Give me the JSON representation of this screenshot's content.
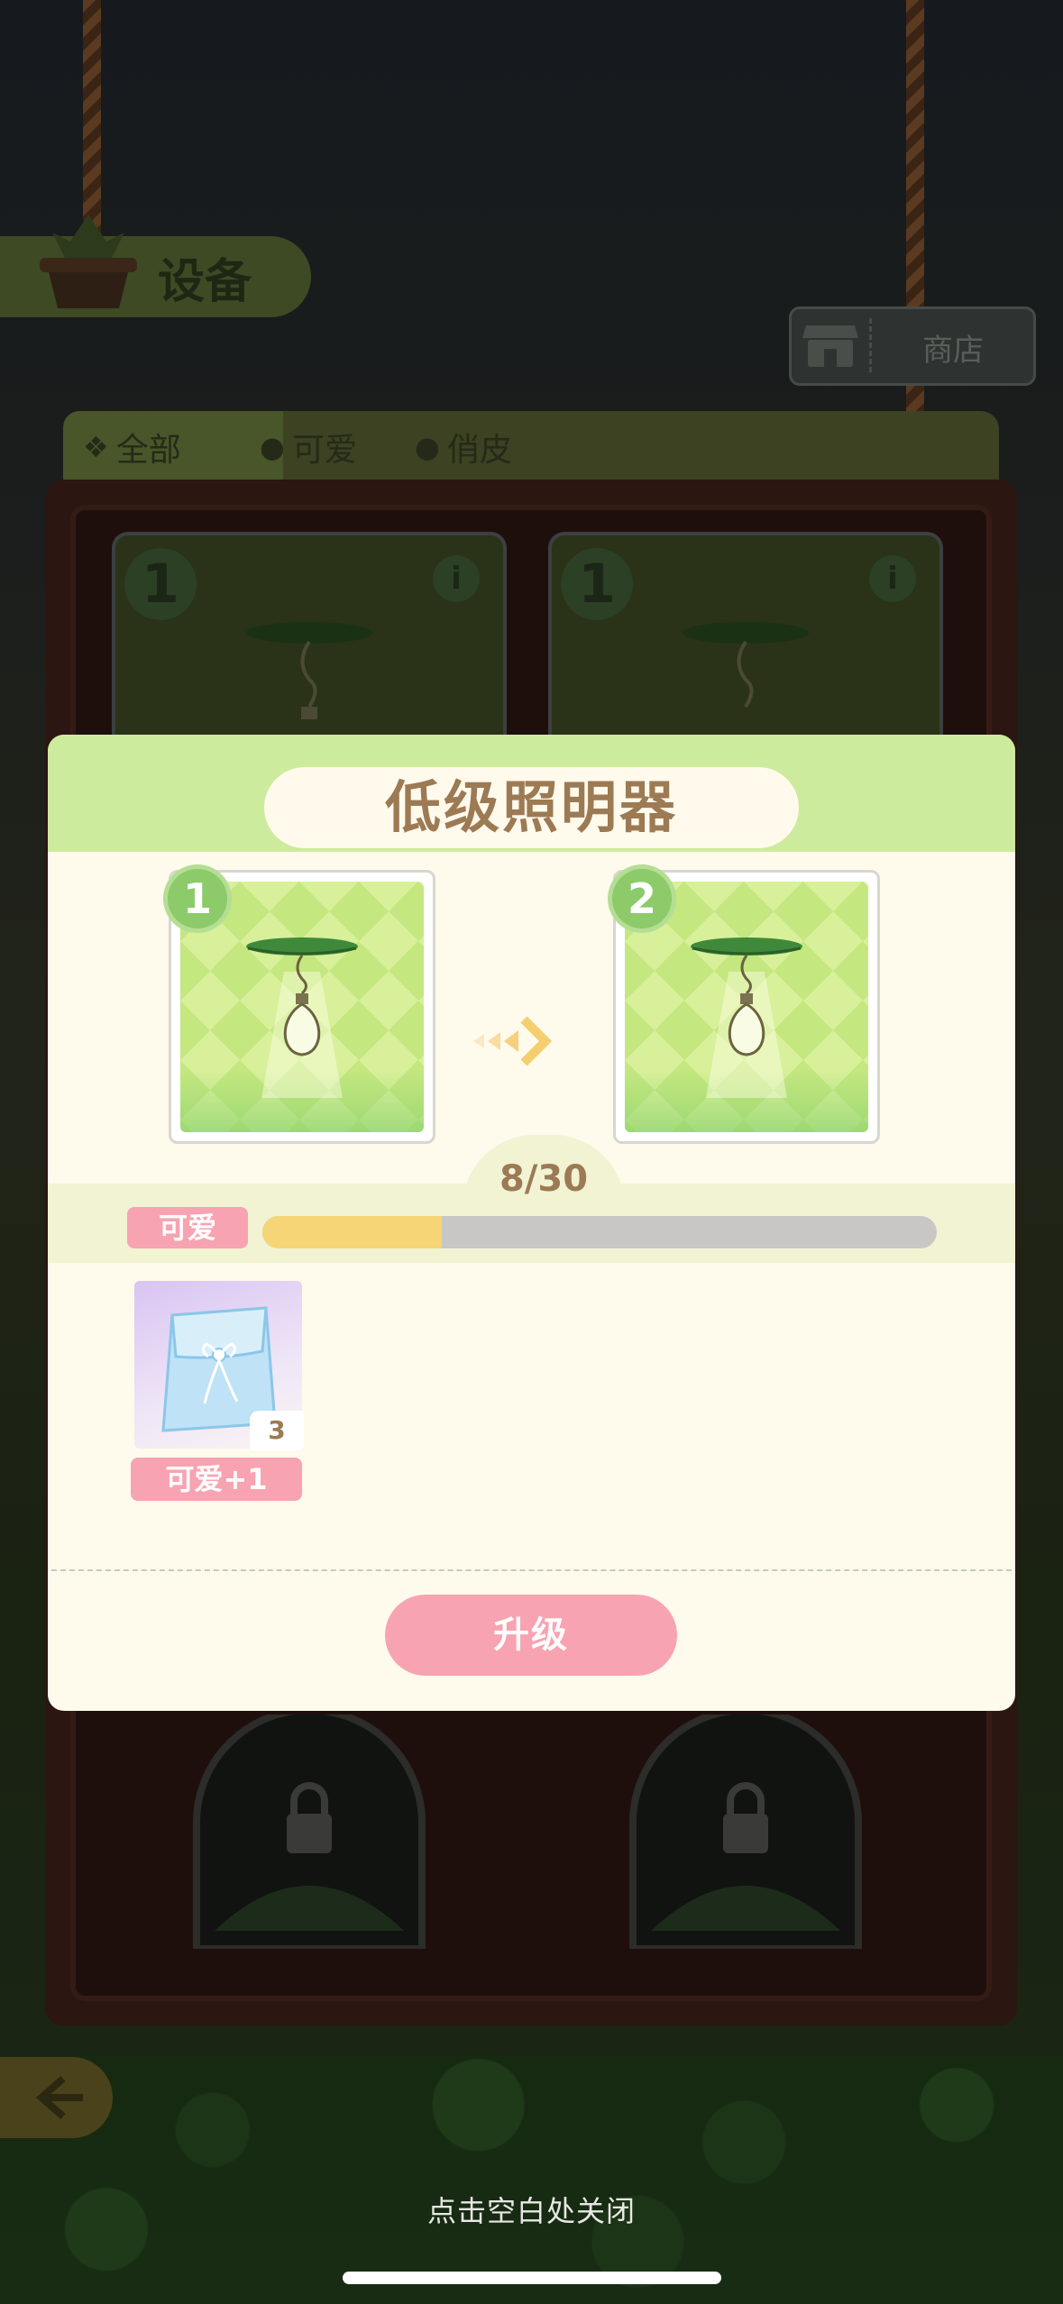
{
  "header": {
    "title": "设备"
  },
  "shop": {
    "label": "商店"
  },
  "tabs": [
    {
      "label": "全部",
      "active": true
    },
    {
      "label": "可爱",
      "active": false
    },
    {
      "label": "俏皮",
      "active": false
    }
  ],
  "shelf": {
    "cards": [
      {
        "level": "1",
        "info": "i"
      },
      {
        "level": "1",
        "info": "i"
      }
    ]
  },
  "modal": {
    "title": "低级照明器",
    "from_level": "1",
    "to_level": "2",
    "progress": {
      "text": "8/30",
      "current": 8,
      "max": 30,
      "tag": "可爱"
    },
    "reward": {
      "count": "3",
      "label": "可爱+1"
    },
    "upgrade_label": "升级"
  },
  "footer": {
    "close_hint": "点击空白处关闭"
  },
  "colors": {
    "accent_pink": "#f8a3b1",
    "progress_fill": "#f5d575",
    "header_green": "#cdeb9d",
    "title_brown": "#9c7a54"
  }
}
